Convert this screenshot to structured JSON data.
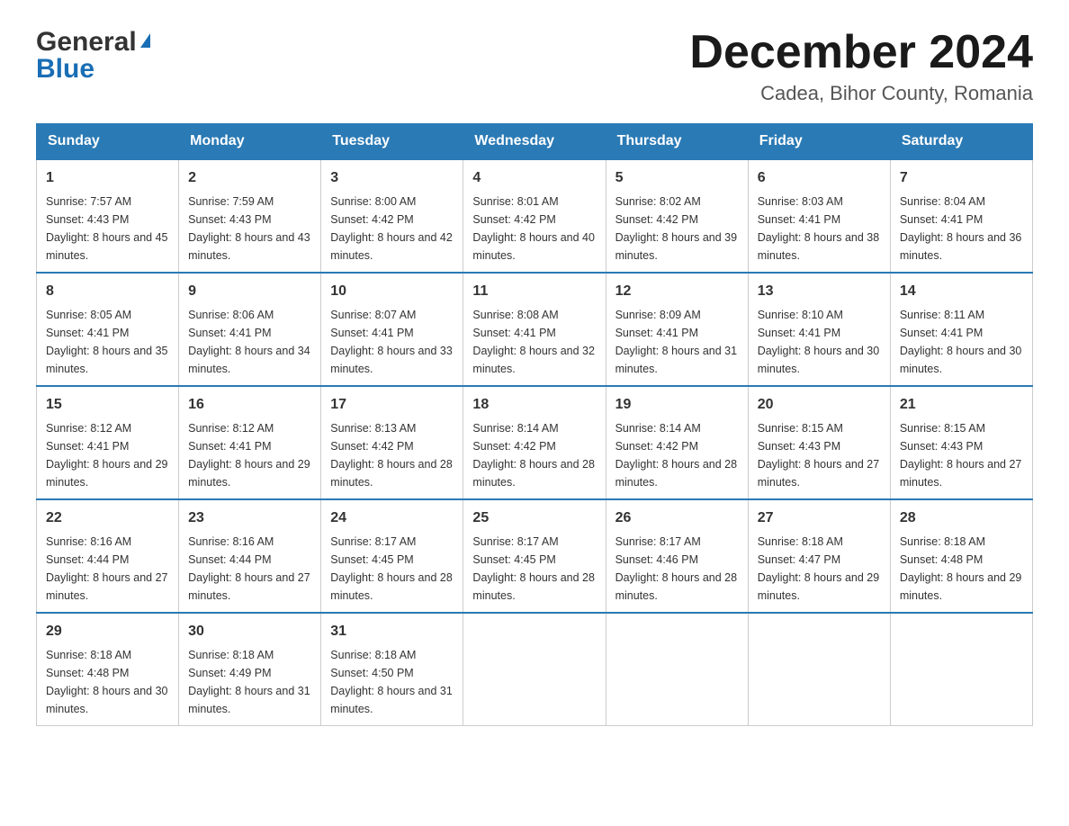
{
  "logo": {
    "general": "General",
    "blue": "Blue",
    "triangle": "▲"
  },
  "title": "December 2024",
  "location": "Cadea, Bihor County, Romania",
  "days_of_week": [
    "Sunday",
    "Monday",
    "Tuesday",
    "Wednesday",
    "Thursday",
    "Friday",
    "Saturday"
  ],
  "weeks": [
    [
      {
        "day": "1",
        "sunrise": "7:57 AM",
        "sunset": "4:43 PM",
        "daylight": "8 hours and 45 minutes."
      },
      {
        "day": "2",
        "sunrise": "7:59 AM",
        "sunset": "4:43 PM",
        "daylight": "8 hours and 43 minutes."
      },
      {
        "day": "3",
        "sunrise": "8:00 AM",
        "sunset": "4:42 PM",
        "daylight": "8 hours and 42 minutes."
      },
      {
        "day": "4",
        "sunrise": "8:01 AM",
        "sunset": "4:42 PM",
        "daylight": "8 hours and 40 minutes."
      },
      {
        "day": "5",
        "sunrise": "8:02 AM",
        "sunset": "4:42 PM",
        "daylight": "8 hours and 39 minutes."
      },
      {
        "day": "6",
        "sunrise": "8:03 AM",
        "sunset": "4:41 PM",
        "daylight": "8 hours and 38 minutes."
      },
      {
        "day": "7",
        "sunrise": "8:04 AM",
        "sunset": "4:41 PM",
        "daylight": "8 hours and 36 minutes."
      }
    ],
    [
      {
        "day": "8",
        "sunrise": "8:05 AM",
        "sunset": "4:41 PM",
        "daylight": "8 hours and 35 minutes."
      },
      {
        "day": "9",
        "sunrise": "8:06 AM",
        "sunset": "4:41 PM",
        "daylight": "8 hours and 34 minutes."
      },
      {
        "day": "10",
        "sunrise": "8:07 AM",
        "sunset": "4:41 PM",
        "daylight": "8 hours and 33 minutes."
      },
      {
        "day": "11",
        "sunrise": "8:08 AM",
        "sunset": "4:41 PM",
        "daylight": "8 hours and 32 minutes."
      },
      {
        "day": "12",
        "sunrise": "8:09 AM",
        "sunset": "4:41 PM",
        "daylight": "8 hours and 31 minutes."
      },
      {
        "day": "13",
        "sunrise": "8:10 AM",
        "sunset": "4:41 PM",
        "daylight": "8 hours and 30 minutes."
      },
      {
        "day": "14",
        "sunrise": "8:11 AM",
        "sunset": "4:41 PM",
        "daylight": "8 hours and 30 minutes."
      }
    ],
    [
      {
        "day": "15",
        "sunrise": "8:12 AM",
        "sunset": "4:41 PM",
        "daylight": "8 hours and 29 minutes."
      },
      {
        "day": "16",
        "sunrise": "8:12 AM",
        "sunset": "4:41 PM",
        "daylight": "8 hours and 29 minutes."
      },
      {
        "day": "17",
        "sunrise": "8:13 AM",
        "sunset": "4:42 PM",
        "daylight": "8 hours and 28 minutes."
      },
      {
        "day": "18",
        "sunrise": "8:14 AM",
        "sunset": "4:42 PM",
        "daylight": "8 hours and 28 minutes."
      },
      {
        "day": "19",
        "sunrise": "8:14 AM",
        "sunset": "4:42 PM",
        "daylight": "8 hours and 28 minutes."
      },
      {
        "day": "20",
        "sunrise": "8:15 AM",
        "sunset": "4:43 PM",
        "daylight": "8 hours and 27 minutes."
      },
      {
        "day": "21",
        "sunrise": "8:15 AM",
        "sunset": "4:43 PM",
        "daylight": "8 hours and 27 minutes."
      }
    ],
    [
      {
        "day": "22",
        "sunrise": "8:16 AM",
        "sunset": "4:44 PM",
        "daylight": "8 hours and 27 minutes."
      },
      {
        "day": "23",
        "sunrise": "8:16 AM",
        "sunset": "4:44 PM",
        "daylight": "8 hours and 27 minutes."
      },
      {
        "day": "24",
        "sunrise": "8:17 AM",
        "sunset": "4:45 PM",
        "daylight": "8 hours and 28 minutes."
      },
      {
        "day": "25",
        "sunrise": "8:17 AM",
        "sunset": "4:45 PM",
        "daylight": "8 hours and 28 minutes."
      },
      {
        "day": "26",
        "sunrise": "8:17 AM",
        "sunset": "4:46 PM",
        "daylight": "8 hours and 28 minutes."
      },
      {
        "day": "27",
        "sunrise": "8:18 AM",
        "sunset": "4:47 PM",
        "daylight": "8 hours and 29 minutes."
      },
      {
        "day": "28",
        "sunrise": "8:18 AM",
        "sunset": "4:48 PM",
        "daylight": "8 hours and 29 minutes."
      }
    ],
    [
      {
        "day": "29",
        "sunrise": "8:18 AM",
        "sunset": "4:48 PM",
        "daylight": "8 hours and 30 minutes."
      },
      {
        "day": "30",
        "sunrise": "8:18 AM",
        "sunset": "4:49 PM",
        "daylight": "8 hours and 31 minutes."
      },
      {
        "day": "31",
        "sunrise": "8:18 AM",
        "sunset": "4:50 PM",
        "daylight": "8 hours and 31 minutes."
      },
      null,
      null,
      null,
      null
    ]
  ],
  "labels": {
    "sunrise": "Sunrise:",
    "sunset": "Sunset:",
    "daylight": "Daylight:"
  }
}
